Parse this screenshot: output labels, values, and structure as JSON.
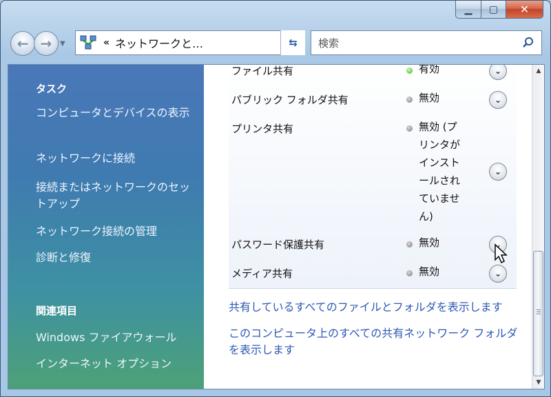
{
  "window": {
    "caption_buttons": [
      "minimize",
      "maximize",
      "close"
    ]
  },
  "nav": {
    "address_chevron": "«",
    "address_path": "ネットワークと…",
    "search_placeholder": "検索",
    "back_icon": "back-arrow-icon",
    "forward_icon": "forward-arrow-icon",
    "refresh_icon": "refresh-icon",
    "search_icon": "magnifier-icon"
  },
  "sidebar": {
    "tasks_heading": "タスク",
    "tasks": [
      "コンピュータとデバイスの表示",
      "ネットワークに接続",
      "接続またはネットワークのセットアップ",
      "ネットワーク接続の管理",
      "診断と修復"
    ],
    "related_heading": "関連項目",
    "related": [
      "Windows ファイアウォール",
      "インターネット オプション"
    ]
  },
  "sharing": {
    "items": [
      {
        "name": "ファイル共有",
        "status": "有効",
        "on": true
      },
      {
        "name": "パブリック フォルダ共有",
        "status": "無効",
        "on": false
      },
      {
        "name": "プリンタ共有",
        "status": "無効 (プリンタがインストールされていません)",
        "on": false
      },
      {
        "name": "パスワード保護共有",
        "status": "無効",
        "on": false
      },
      {
        "name": "メディア共有",
        "status": "無効",
        "on": false
      }
    ]
  },
  "links": [
    "共有しているすべてのファイルとフォルダを表示します",
    "このコンピュータ上のすべての共有ネットワーク フォルダを表示します"
  ],
  "colors": {
    "link": "#2d58b4",
    "enabled_dot": "#36b51a",
    "disabled_dot": "#7b7b7b"
  }
}
